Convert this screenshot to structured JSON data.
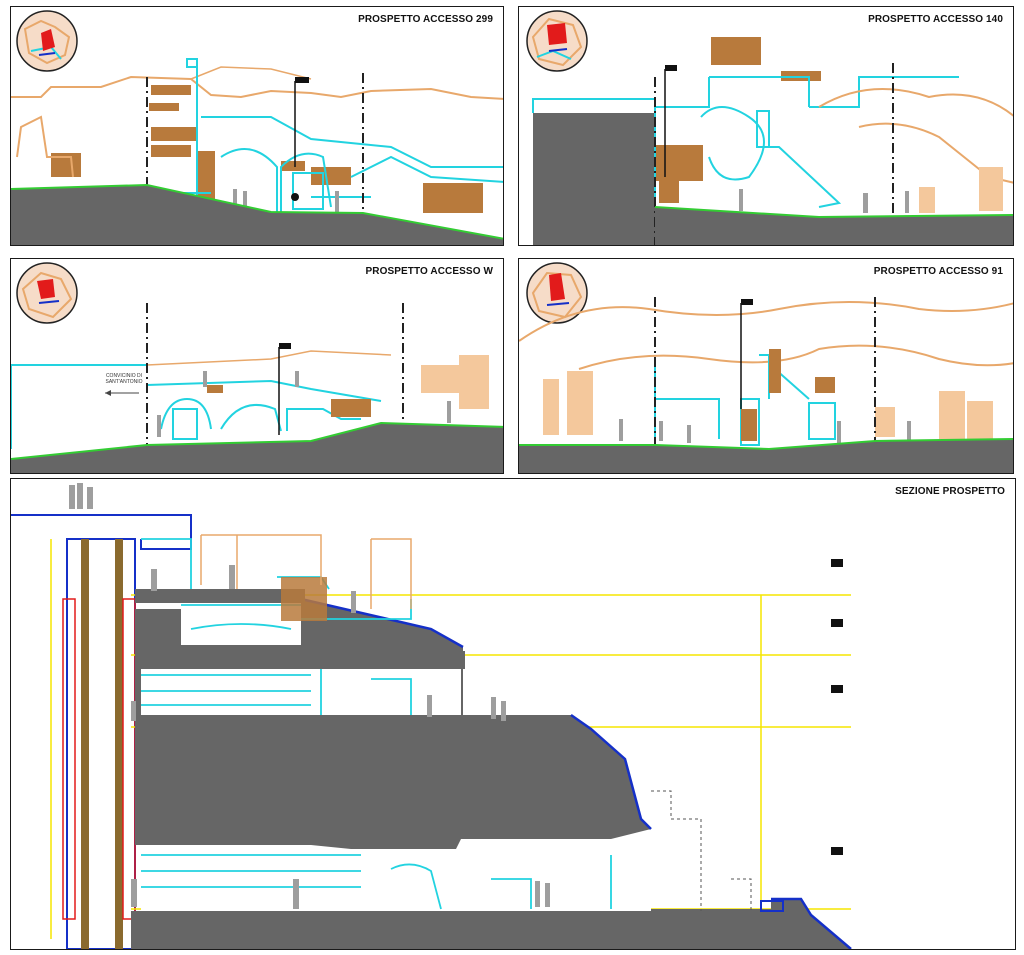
{
  "drawing": {
    "panels": [
      {
        "id": "p299",
        "title": "PROSPETTO ACCESSO 299"
      },
      {
        "id": "p140",
        "title": "PROSPETTO ACCESSO 140"
      },
      {
        "id": "pW",
        "title": "PROSPETTO ACCESSO W",
        "annotation": "CONVICINIO DI SANT'ANTONIO"
      },
      {
        "id": "p91",
        "title": "PROSPETTO ACCESSO 91"
      },
      {
        "id": "section",
        "title": "SEZIONE PROSPETTO"
      }
    ],
    "palette": {
      "ground": "#666666",
      "terrain_line": "#33cc33",
      "rock_outline": "#e8a86b",
      "masonry_fill": "#b87a3c",
      "cyan_lines": "#22d3e0",
      "level_lines": "#f5e600",
      "section_outline": "#1530c8",
      "locator_mark": "#e21b1b",
      "figures": "#9e9e9e"
    }
  }
}
